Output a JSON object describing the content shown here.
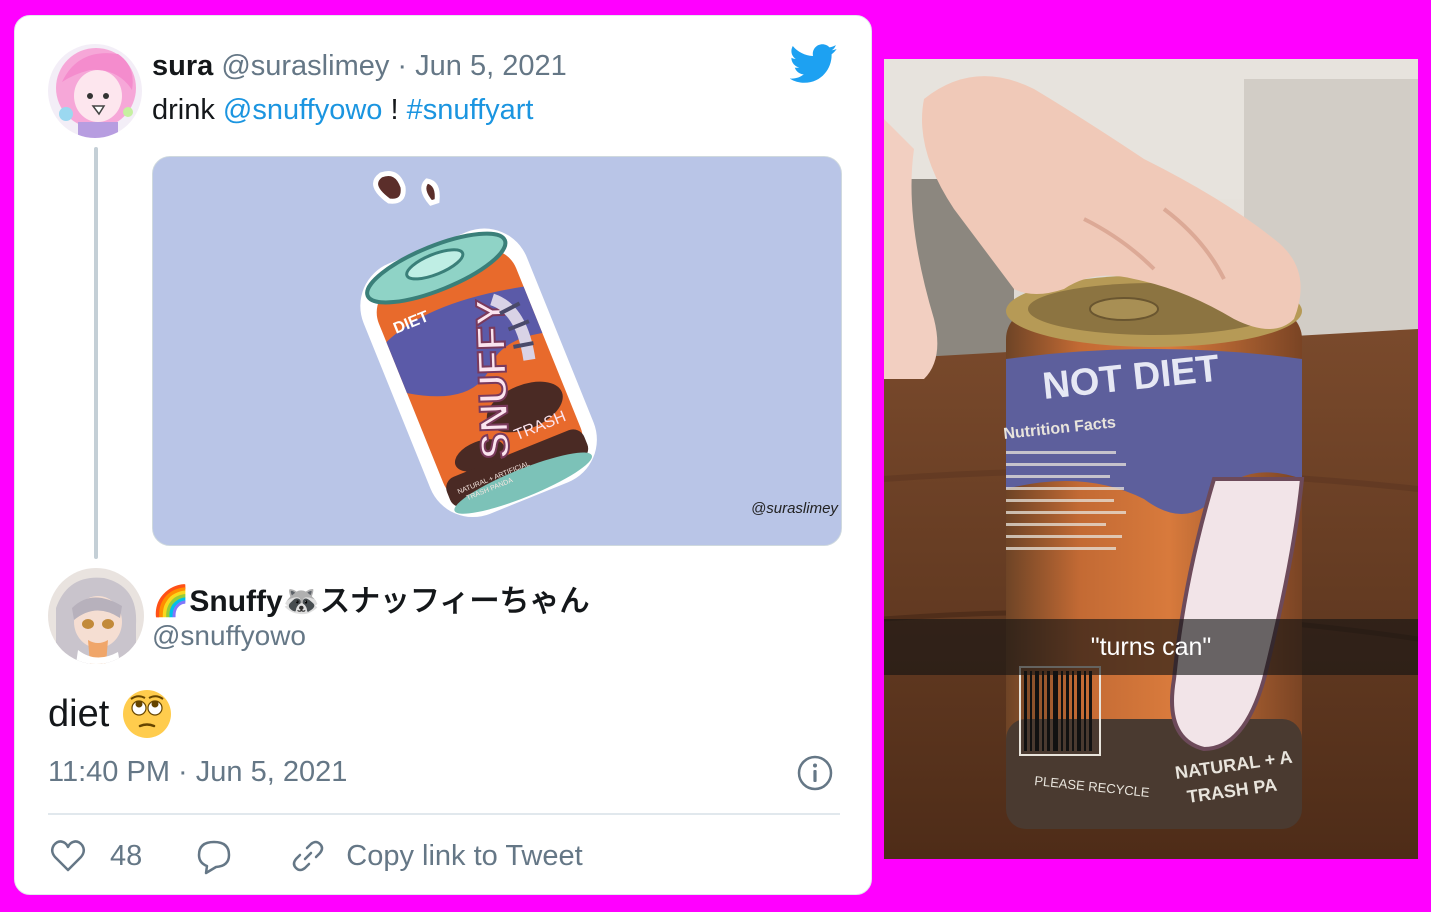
{
  "tweet1": {
    "name": "sura",
    "handle": "@suraslimey",
    "separator": "·",
    "date": "Jun 5, 2021",
    "text_prefix": "drink",
    "mention": "@snuffyowo",
    "text_mid": "!",
    "hashtag": "#snuffyart"
  },
  "media_art": {
    "label_diet": "DIET",
    "brand": "SNUFFY",
    "flavor": "TRASH",
    "fine_print_1": "NATURAL + ARTIFICIAL",
    "fine_print_2": "TRASH PANDA",
    "signature": "@suraslimey"
  },
  "tweet2": {
    "name_prefix_emoji": "🌈",
    "name": "Snuffy",
    "name_emoji": "🦝",
    "name_suffix": "スナッフィーちゃん",
    "handle": "@snuffyowo",
    "text": "diet",
    "emoji": "face-with-rolling-eyes",
    "time": "11:40 PM",
    "separator": "·",
    "date": "Jun 5, 2021",
    "likes": "48",
    "copy_link_label": "Copy link to Tweet"
  },
  "photo": {
    "can_label": "NOT DIET",
    "can_text_1": "Nutrition Facts",
    "can_text_2": "NATURAL + A",
    "can_text_3": "TRASH PA",
    "can_text_4": "PLEASE RECYCLE",
    "caption": "\"turns can\""
  },
  "colors": {
    "background": "#ff00ff",
    "twitter_blue": "#1da1f2",
    "link": "#1b95e0",
    "muted": "#657786"
  }
}
